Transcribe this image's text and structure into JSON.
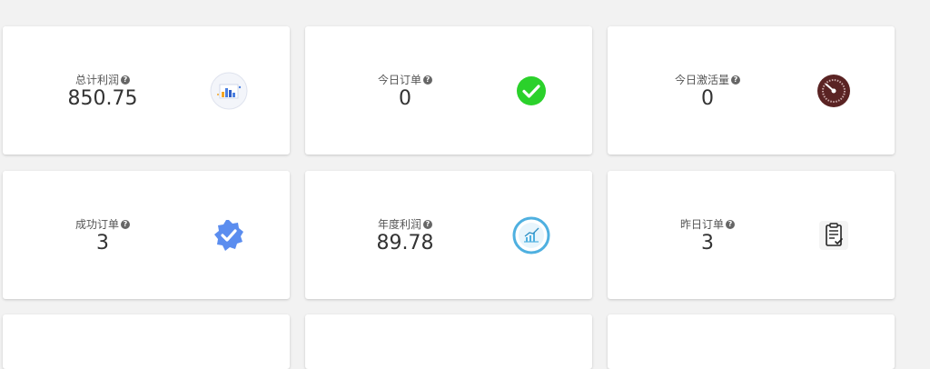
{
  "cards": [
    {
      "label": "总计利润",
      "value": "850.75",
      "icon": "bar-chart-icon"
    },
    {
      "label": "今日订单",
      "value": "0",
      "icon": "check-circle-icon"
    },
    {
      "label": "今日激活量",
      "value": "0",
      "icon": "speedometer-icon"
    },
    {
      "label": "成功订单",
      "value": "3",
      "icon": "verified-badge-icon"
    },
    {
      "label": "年度利润",
      "value": "89.78",
      "icon": "line-chart-icon"
    },
    {
      "label": "昨日订单",
      "value": "3",
      "icon": "clipboard-check-icon"
    }
  ],
  "help_glyph": "?",
  "colors": {
    "background": "#f2f2f2",
    "card": "#ffffff",
    "check_green": "#2bd12b",
    "badge_blue": "#5b8def",
    "gauge_brown": "#5a2323",
    "chart_blue": "#4fb0e0"
  }
}
